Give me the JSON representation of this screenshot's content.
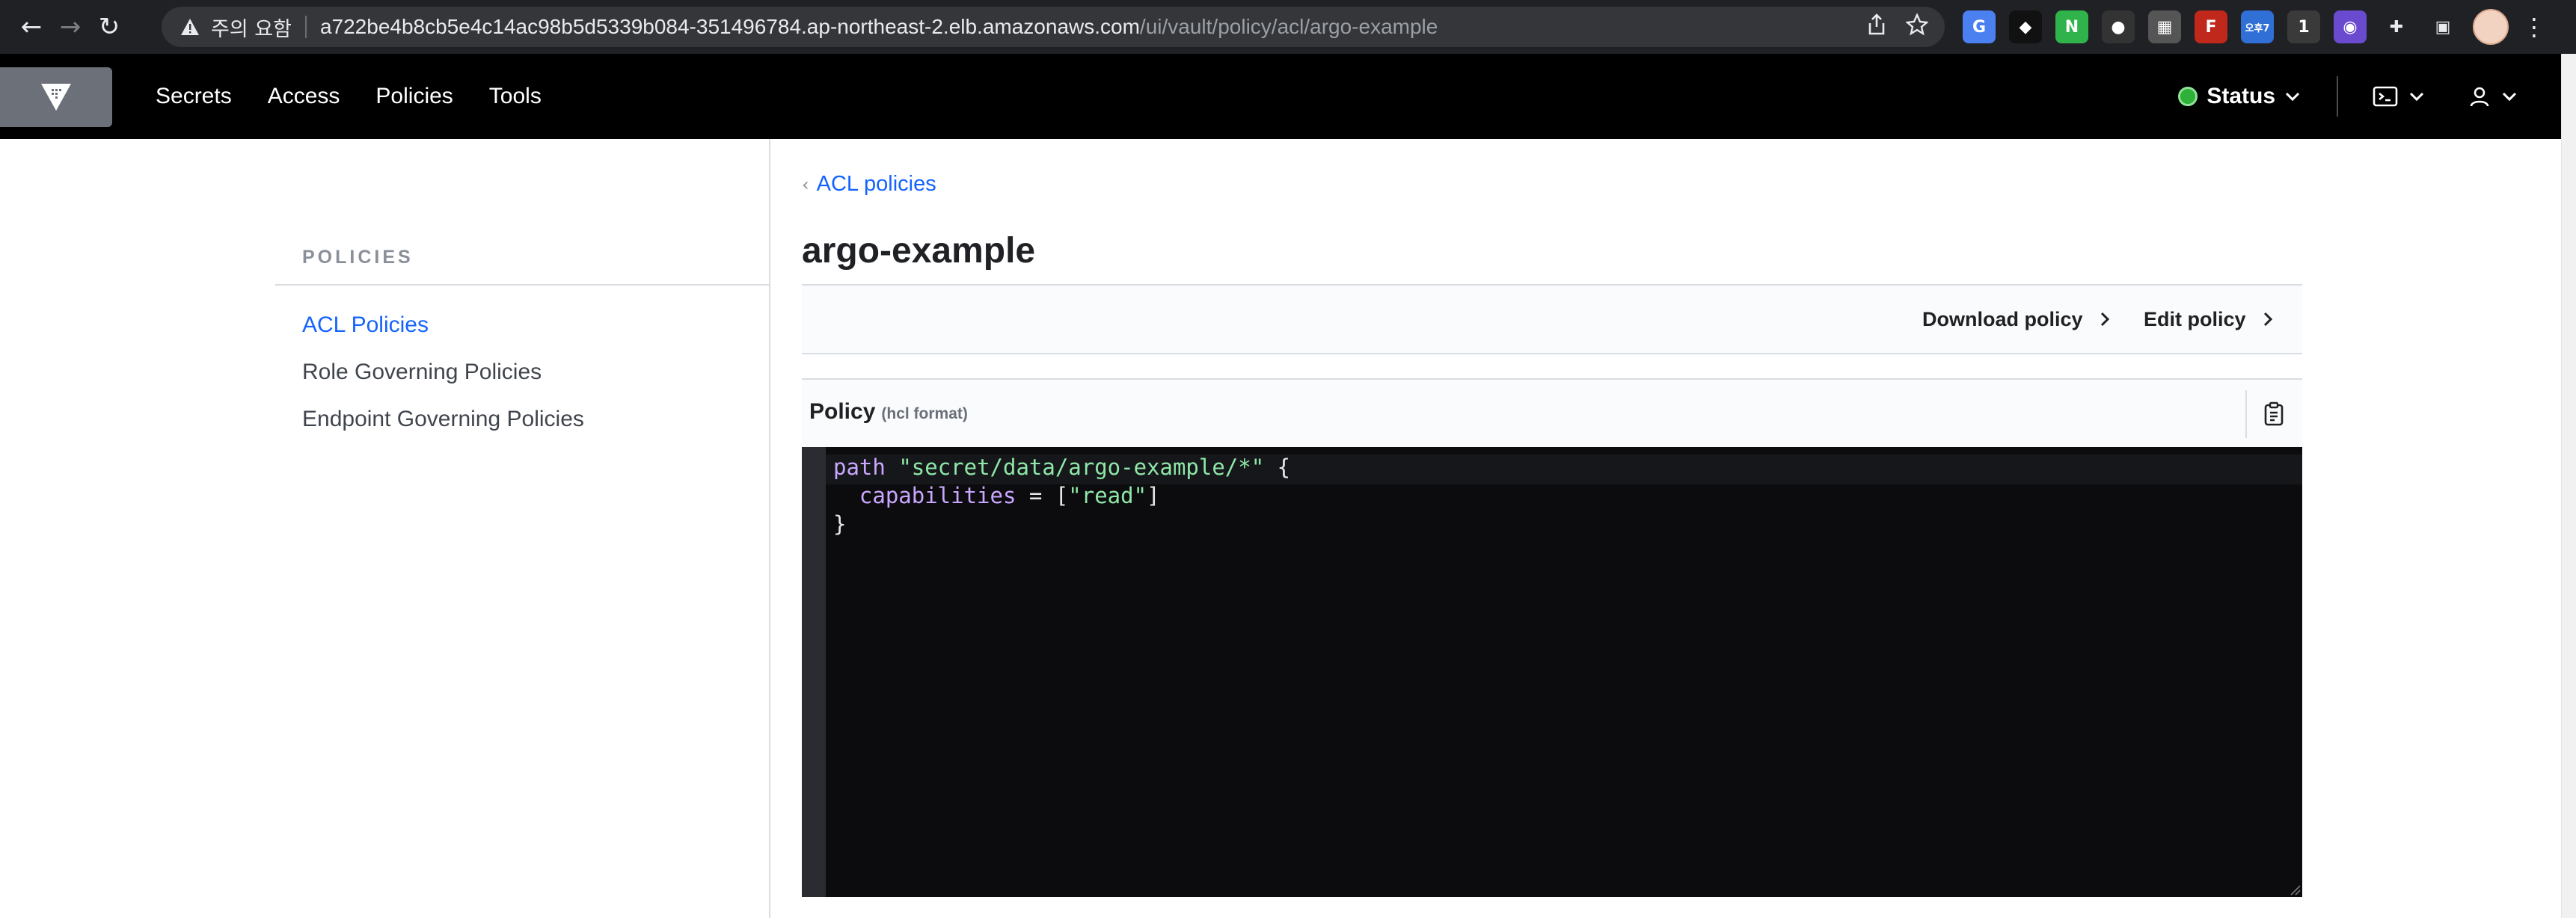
{
  "browser": {
    "security_label": "주의 요함",
    "url_host": "a722be4b8cb5e4c14ac98b5d5339b084-351496784.ap-northeast-2.elb.amazonaws.com",
    "url_path": "/ui/vault/policy/acl/argo-example",
    "extensions": [
      {
        "name": "google-translate-icon",
        "glyph": "G",
        "color": "#4a80f0"
      },
      {
        "name": "extension-dark-icon",
        "glyph": "◆",
        "color": "#111111"
      },
      {
        "name": "extension-n-icon",
        "glyph": "N",
        "color": "#2fb34a"
      },
      {
        "name": "extension-circle-icon",
        "glyph": "●",
        "color": "#333333"
      },
      {
        "name": "qr-code-icon",
        "glyph": "▦",
        "color": "#555555"
      },
      {
        "name": "extension-f-icon",
        "glyph": "F",
        "color": "#c0281c"
      },
      {
        "name": "calendar-ext-icon",
        "glyph": "오후7",
        "color": "#2f6fd6"
      },
      {
        "name": "extension-badge-icon",
        "glyph": "1",
        "color": "#3a3a3a"
      },
      {
        "name": "extension-color-icon",
        "glyph": "◉",
        "color": "#6a4bd0"
      }
    ]
  },
  "header": {
    "nav": [
      "Secrets",
      "Access",
      "Policies",
      "Tools"
    ],
    "status_label": "Status",
    "status_color": "#2eb039"
  },
  "sidebar": {
    "title": "POLICIES",
    "items": [
      {
        "label": "ACL Policies",
        "active": true
      },
      {
        "label": "Role Governing Policies",
        "active": false
      },
      {
        "label": "Endpoint Governing Policies",
        "active": false
      }
    ]
  },
  "content": {
    "breadcrumb": "ACL policies",
    "title": "argo-example",
    "actions": {
      "download": "Download policy",
      "edit": "Edit policy"
    },
    "policy": {
      "label": "Policy",
      "format": "(hcl format)",
      "code": {
        "line1_kw": "path",
        "line1_str": "\"secret/data/argo-example/*\"",
        "line1_brace": "{",
        "line2_prop": "capabilities",
        "line2_eq": "= [",
        "line2_str": "\"read\"",
        "line2_end": "]",
        "line3": "}"
      }
    }
  },
  "colors": {
    "accent": "#1563ff",
    "header_bg": "#000000",
    "editor_bg": "#0c0c0e"
  }
}
